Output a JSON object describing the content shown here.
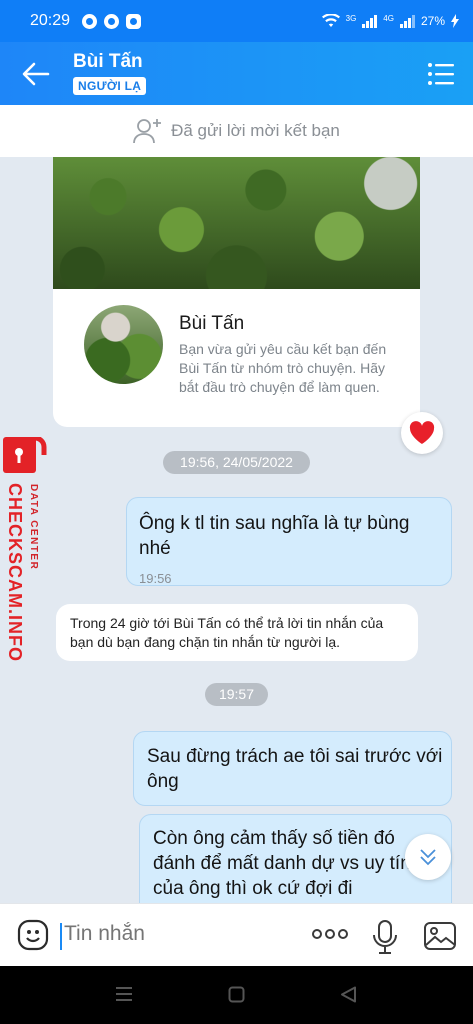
{
  "status_bar": {
    "time": "20:29",
    "network_1": "3G",
    "network_2": "4G",
    "battery": "27%"
  },
  "header": {
    "title": "Bùi Tấn",
    "badge": "NGƯỜI LẠ"
  },
  "friend_request": {
    "text": "Đã gửi lời mời kết bạn"
  },
  "profile_card": {
    "name": "Bùi Tấn",
    "description": "Bạn vừa gửi yêu cầu kết bạn đến Bùi Tấn từ nhóm trò chuyện. Hãy bắt đầu trò chuyện để làm quen."
  },
  "messages": {
    "timestamp_1": "19:56, 24/05/2022",
    "msg_1_text": "Ông k tl tin sau nghĩa là tự bùng nhé",
    "msg_1_time": "19:56",
    "system_note": "Trong 24 giờ tới Bùi Tấn có thể trả lời tin nhắn của bạn dù bạn đang chặn tin nhắn từ người lạ.",
    "timestamp_2": "19:57",
    "msg_2_text": "Sau đừng trách ae tôi sai trước với ông",
    "msg_3_text": "Còn ông cảm thấy số tiền đó đánh để mất danh dự vs uy tín của ông thì ok cứ đợi đi"
  },
  "watermark": {
    "main": "CHECKSCAM.INFO",
    "sub": "DATA CENTER"
  },
  "input_bar": {
    "placeholder": "Tin nhắn"
  },
  "colors": {
    "header_blue": "#1e86f8",
    "outgoing_bubble": "#d4ecfd",
    "watermark_red": "#e32227"
  }
}
